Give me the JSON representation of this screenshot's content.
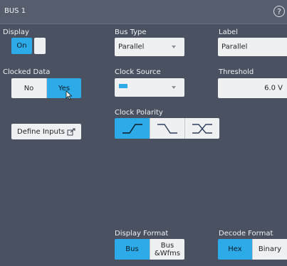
{
  "window": {
    "title": "BUS 1",
    "help_icon": "?"
  },
  "display": {
    "label": "Display",
    "on_label": "On"
  },
  "bus_type": {
    "label": "Bus Type",
    "value": "Parallel"
  },
  "label_field": {
    "label": "Label",
    "value": "Parallel"
  },
  "clocked_data": {
    "label": "Clocked Data",
    "options": [
      "No",
      "Yes"
    ],
    "selected": "Yes"
  },
  "clock_source": {
    "label": "Clock Source",
    "swatch_color": "#2cabe8"
  },
  "threshold": {
    "label": "Threshold",
    "value": "6.0 V"
  },
  "clock_polarity": {
    "label": "Clock Polarity",
    "options": [
      "rising-edge-icon",
      "falling-edge-icon",
      "either-edge-icon"
    ],
    "selected": "rising-edge-icon"
  },
  "define_inputs": {
    "label": "Define Inputs",
    "icon": "external-link-icon"
  },
  "display_format": {
    "label": "Display Format",
    "options": [
      "Bus",
      "Bus\n&Wfms"
    ],
    "selected": "Bus"
  },
  "decode_format": {
    "label": "Decode Format",
    "options": [
      "Hex",
      "Binary"
    ],
    "selected": "Hex"
  },
  "colors": {
    "accent": "#2cabe8",
    "panel": "#4a5160",
    "titlebar": "#565e6d"
  }
}
